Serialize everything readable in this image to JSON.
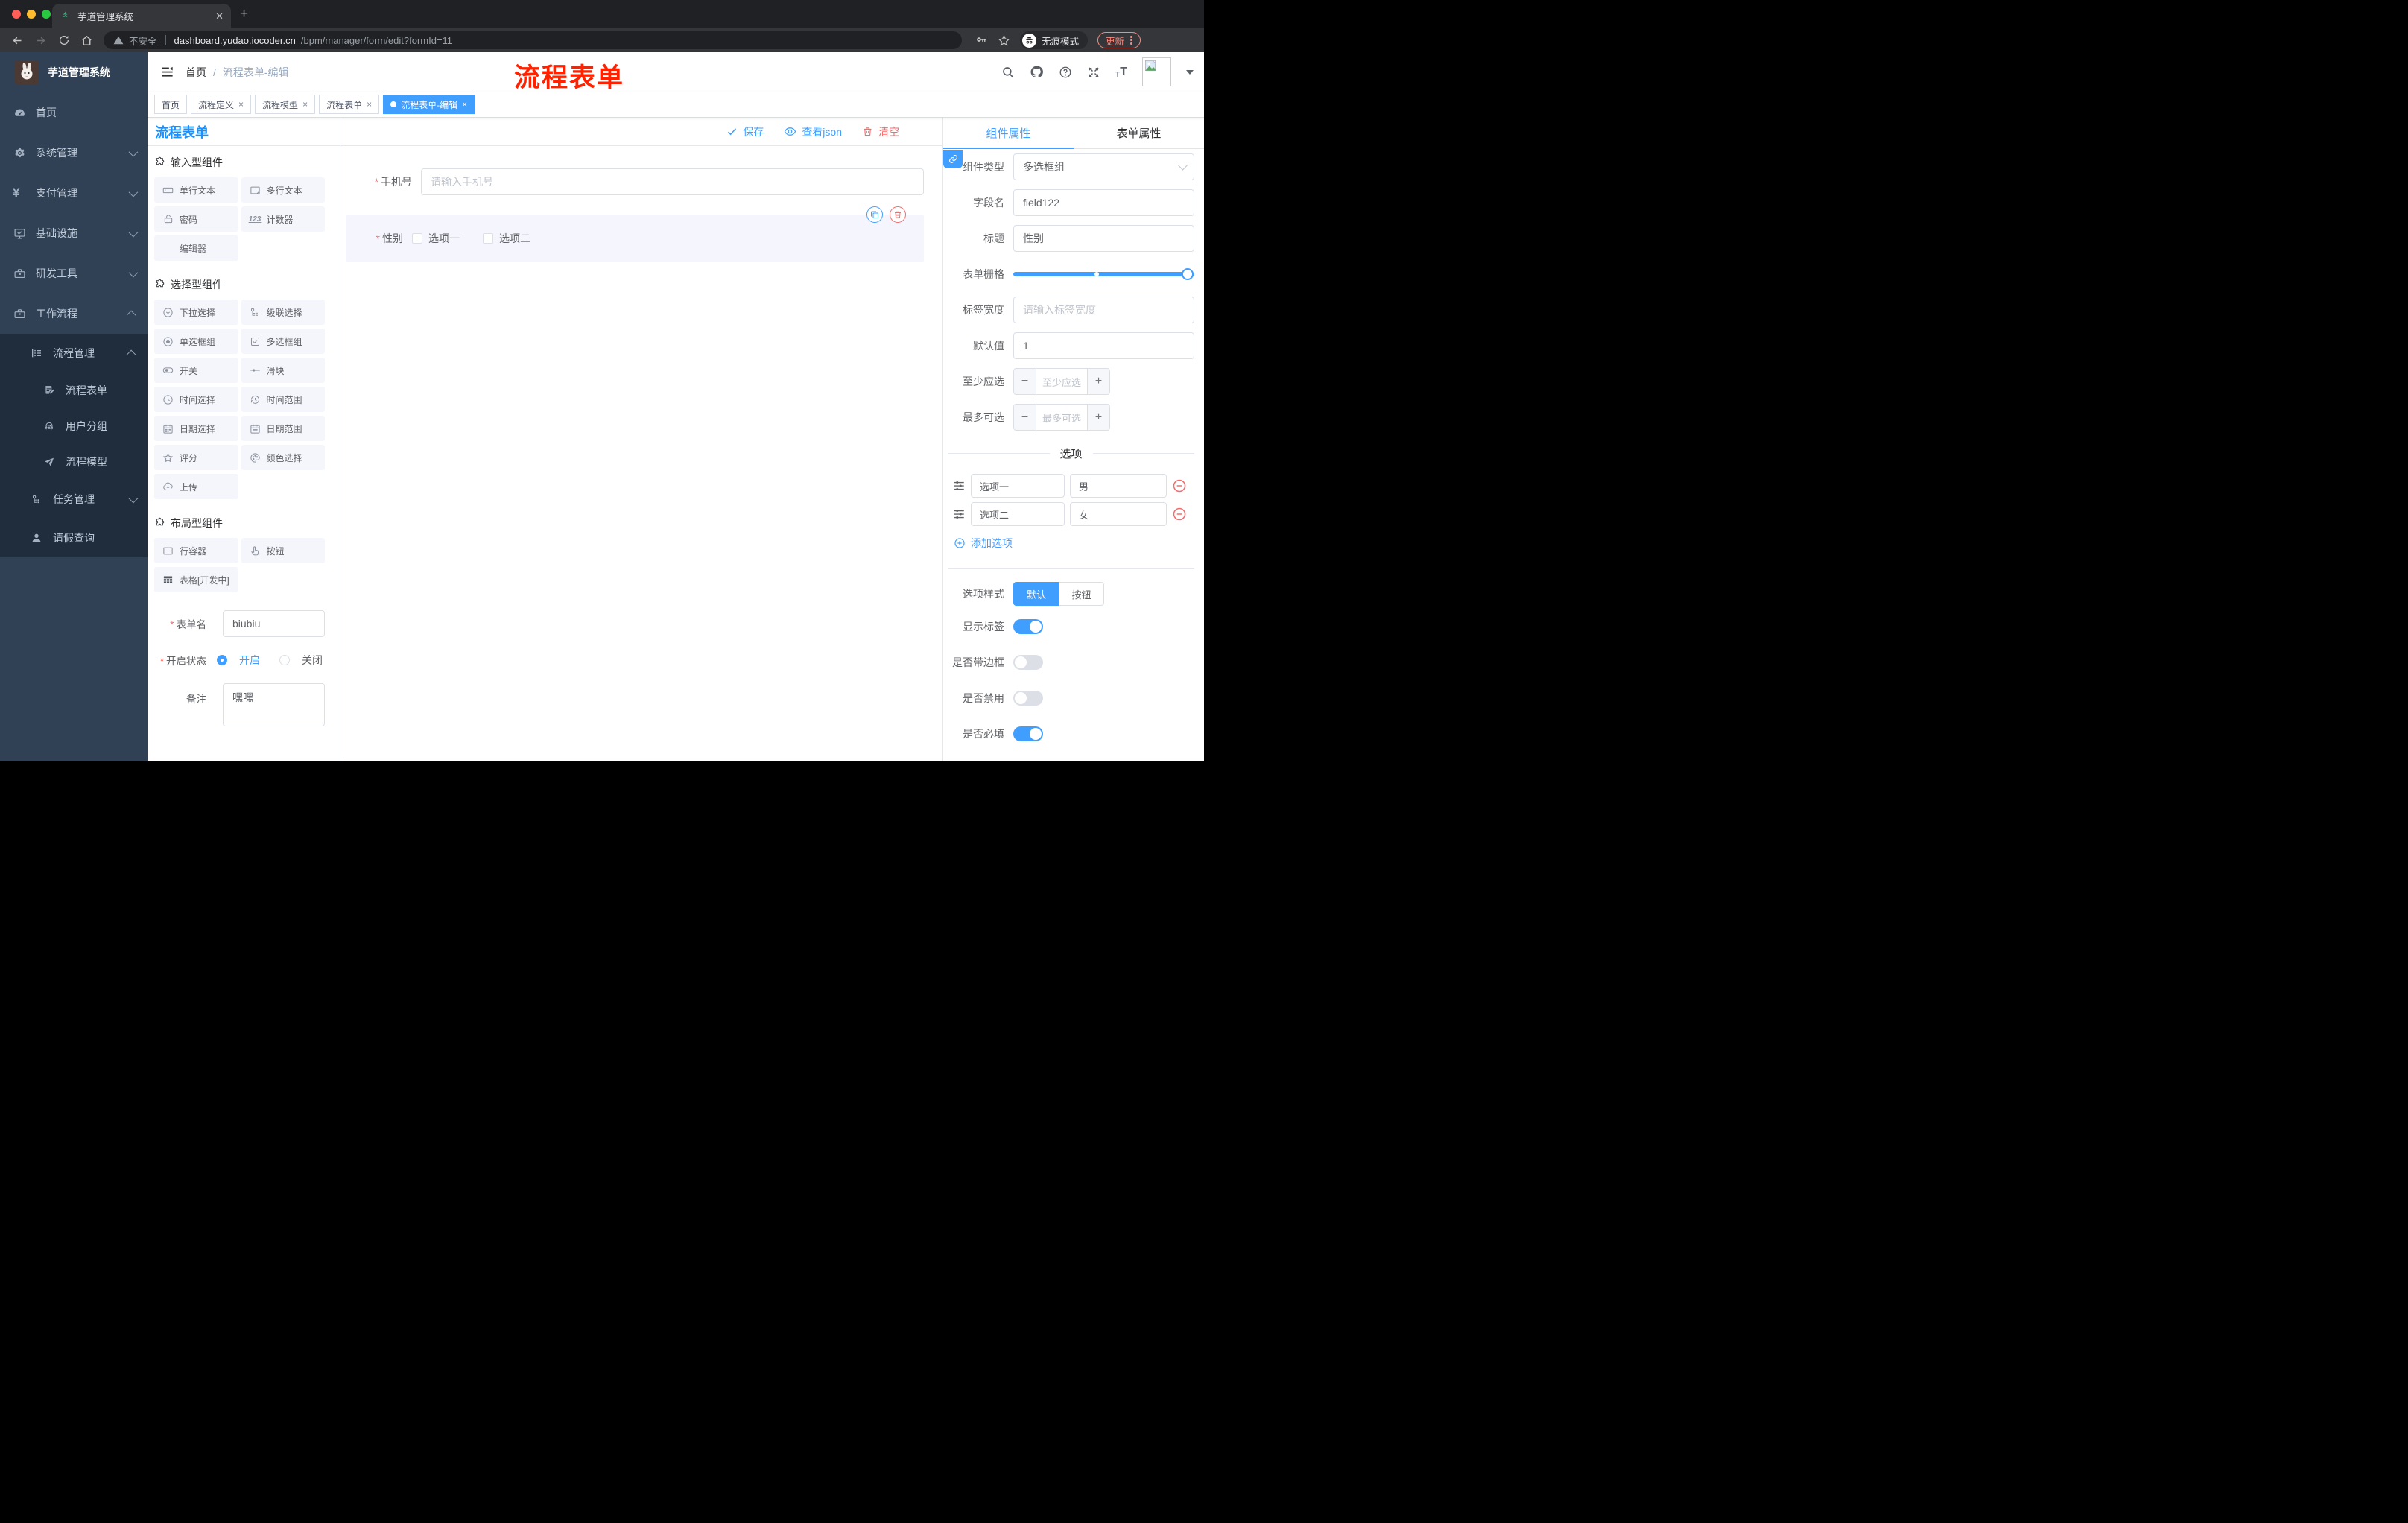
{
  "browser": {
    "tab_title": "芋道管理系统",
    "close_tab": "✕",
    "new_tab": "+",
    "security_label": "不安全",
    "url_domain": "dashboard.yudao.iocoder.cn",
    "url_path": "/bpm/manager/form/edit?formId=11",
    "incognito_label": "无痕模式",
    "update_label": "更新"
  },
  "sidebar": {
    "app_title": "芋道管理系统",
    "items": [
      {
        "label": "首页"
      },
      {
        "label": "系统管理"
      },
      {
        "label": "支付管理"
      },
      {
        "label": "基础设施"
      },
      {
        "label": "研发工具"
      },
      {
        "label": "工作流程"
      },
      {
        "label": "流程管理"
      },
      {
        "label": "流程表单"
      },
      {
        "label": "用户分组"
      },
      {
        "label": "流程模型"
      },
      {
        "label": "任务管理"
      },
      {
        "label": "请假查询"
      }
    ]
  },
  "header": {
    "breadcrumb_home": "首页",
    "breadcrumb_sep": "/",
    "breadcrumb_current": "流程表单-编辑",
    "watermark": "流程表单"
  },
  "tags": [
    {
      "label": "首页"
    },
    {
      "label": "流程定义",
      "close": "×"
    },
    {
      "label": "流程模型",
      "close": "×"
    },
    {
      "label": "流程表单",
      "close": "×"
    },
    {
      "label": "流程表单-编辑",
      "close": "×"
    }
  ],
  "components_panel": {
    "title": "流程表单",
    "sections": [
      {
        "title": "输入型组件",
        "items": [
          {
            "label": "单行文本"
          },
          {
            "label": "多行文本"
          },
          {
            "label": "密码"
          },
          {
            "label": "计数器"
          },
          {
            "label": "编辑器"
          }
        ]
      },
      {
        "title": "选择型组件",
        "items": [
          {
            "label": "下拉选择"
          },
          {
            "label": "级联选择"
          },
          {
            "label": "单选框组"
          },
          {
            "label": "多选框组"
          },
          {
            "label": "开关"
          },
          {
            "label": "滑块"
          },
          {
            "label": "时间选择"
          },
          {
            "label": "时间范围"
          },
          {
            "label": "日期选择"
          },
          {
            "label": "日期范围"
          },
          {
            "label": "评分"
          },
          {
            "label": "颜色选择"
          },
          {
            "label": "上传"
          }
        ]
      },
      {
        "title": "布局型组件",
        "items": [
          {
            "label": "行容器"
          },
          {
            "label": "按钮"
          },
          {
            "label": "表格[开发中]"
          }
        ]
      }
    ],
    "form": {
      "name_label": "表单名",
      "name_value": "biubiu",
      "status_label": "开启状态",
      "status_on": "开启",
      "status_off": "关闭",
      "remark_label": "备注",
      "remark_value": "嘿嘿"
    }
  },
  "canvas": {
    "toolbar": {
      "save": "保存",
      "view_json": "查看json",
      "clear": "清空"
    },
    "phone_field": {
      "label": "手机号",
      "placeholder": "请输入手机号"
    },
    "gender_field": {
      "label": "性别",
      "option1": "选项一",
      "option2": "选项二"
    }
  },
  "panel": {
    "tab_component": "组件属性",
    "tab_form": "表单属性",
    "rows": {
      "component_type": {
        "label": "组件类型",
        "value": "多选框组"
      },
      "field_name": {
        "label": "字段名",
        "value": "field122"
      },
      "title": {
        "label": "标题",
        "value": "性别"
      },
      "grid": {
        "label": "表单栅格"
      },
      "label_width": {
        "label": "标签宽度",
        "placeholder": "请输入标签宽度"
      },
      "default_value": {
        "label": "默认值",
        "value": "1"
      },
      "min_select": {
        "label": "至少应选",
        "placeholder": "至少应选",
        "minus": "−",
        "plus": "+"
      },
      "max_select": {
        "label": "最多可选",
        "placeholder": "最多可选",
        "minus": "−",
        "plus": "+"
      },
      "options_divider": "选项",
      "options": [
        {
          "label": "选项一",
          "value": "男"
        },
        {
          "label": "选项二",
          "value": "女"
        }
      ],
      "add_option": "添加选项",
      "option_style": {
        "label": "选项样式",
        "opt_default": "默认",
        "opt_button": "按钮"
      },
      "switches": [
        {
          "label": "显示标签",
          "on": true
        },
        {
          "label": "是否带边框",
          "on": false
        },
        {
          "label": "是否禁用",
          "on": false
        },
        {
          "label": "是否必填",
          "on": true
        }
      ]
    }
  },
  "colors": {
    "accent": "#409eff",
    "panel_title_blue": "#1890ff",
    "danger": "#f56c6c",
    "watermark_red": "#ff2200",
    "sidebar_bg": "#304156",
    "sidebar_submenu_bg": "#1f2d3d",
    "chrome_dark": "#202124",
    "chrome_bar": "#35363a",
    "update_button": "#f28b82",
    "component_pill_bg": "#f4f6fc",
    "selected_block_bg": "#f4f5fd"
  }
}
